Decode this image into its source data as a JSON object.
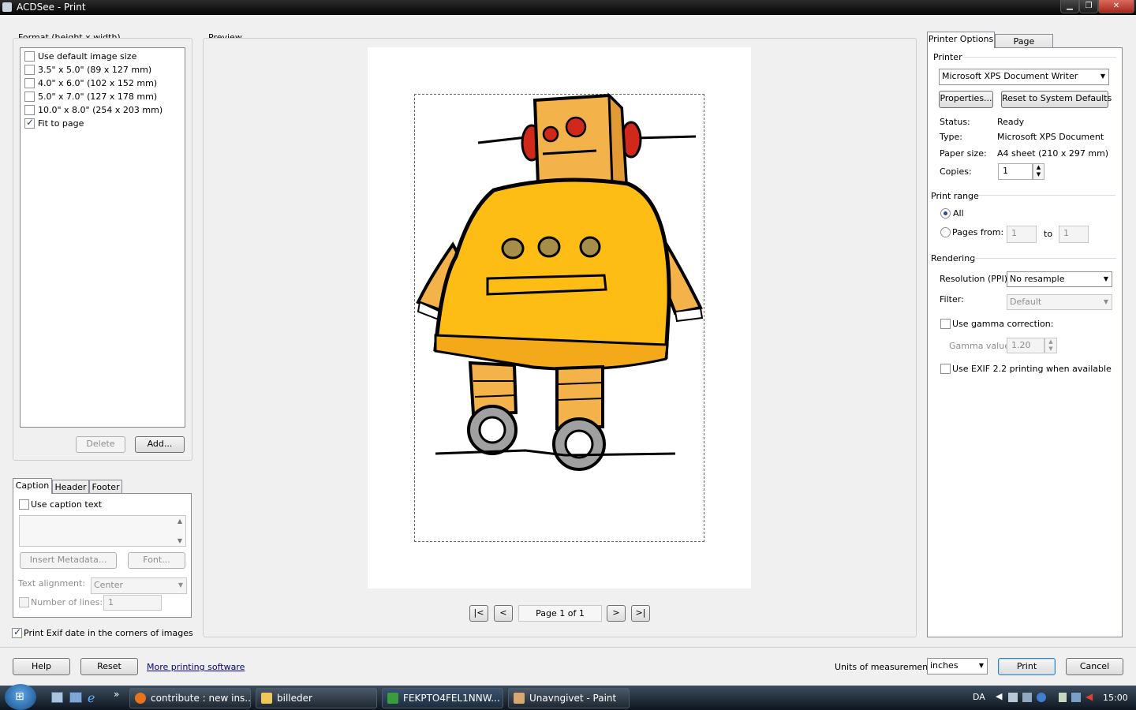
{
  "window": {
    "title": "ACDSee - Print"
  },
  "format": {
    "group_label": "Format (height x width)",
    "items": [
      {
        "label": "Use default image size",
        "checked": false
      },
      {
        "label": "3.5\" x 5.0\" (89 x 127 mm)",
        "checked": false
      },
      {
        "label": "4.0\" x 6.0\" (102 x 152 mm)",
        "checked": false
      },
      {
        "label": "5.0\" x 7.0\" (127 x 178 mm)",
        "checked": false
      },
      {
        "label": "10.0\" x 8.0\" (254 x 203 mm)",
        "checked": false
      },
      {
        "label": "Fit to page",
        "checked": true
      }
    ],
    "delete_label": "Delete",
    "add_label": "Add..."
  },
  "caption": {
    "tabs": [
      "Caption",
      "Header",
      "Footer"
    ],
    "use_caption_label": "Use caption text",
    "insert_metadata_label": "Insert Metadata...",
    "font_label": "Font...",
    "text_alignment_label": "Text alignment:",
    "text_alignment_value": "Center",
    "number_of_lines_label": "Number of lines:",
    "number_of_lines_value": "1"
  },
  "print_exif_label": "Print Exif date in the corners of images",
  "preview": {
    "label": "Preview",
    "page_indicator": "Page 1 of 1",
    "nav": {
      "first": "|<",
      "prev": "<",
      "next": ">",
      "last": ">|"
    }
  },
  "right_tabs": [
    "Printer Options",
    "Page Settings"
  ],
  "printer": {
    "section_label": "Printer",
    "selected": "Microsoft XPS Document Writer",
    "properties_label": "Properties...",
    "reset_label": "Reset to System Defaults",
    "status_label": "Status:",
    "status_value": "Ready",
    "type_label": "Type:",
    "type_value": "Microsoft XPS Document",
    "paper_label": "Paper size:",
    "paper_value": "A4 sheet (210 x 297 mm)",
    "copies_label": "Copies:",
    "copies_value": "1"
  },
  "print_range": {
    "section_label": "Print range",
    "all_label": "All",
    "pages_from_label": "Pages from:",
    "from_value": "1",
    "to_label": "to",
    "to_value": "1"
  },
  "rendering": {
    "section_label": "Rendering",
    "resolution_label": "Resolution (PPI):",
    "resolution_value": "No resample",
    "filter_label": "Filter:",
    "filter_value": "Default",
    "gamma_label": "Use gamma correction:",
    "gamma_value_label": "Gamma value:",
    "gamma_value": "1.20",
    "exif_label": "Use EXIF 2.2 printing when available"
  },
  "bottom": {
    "help_label": "Help",
    "reset_label": "Reset",
    "more_software_label": "More printing software",
    "units_label": "Units of measurement:",
    "units_value": "inches",
    "print_label": "Print",
    "cancel_label": "Cancel"
  },
  "taskbar": {
    "tasks": [
      "contribute : new ins...",
      "billeder",
      "FEKPTO4FEL1NNW...",
      "Unavngivet - Paint"
    ],
    "language": "DA",
    "clock": "15:00"
  }
}
